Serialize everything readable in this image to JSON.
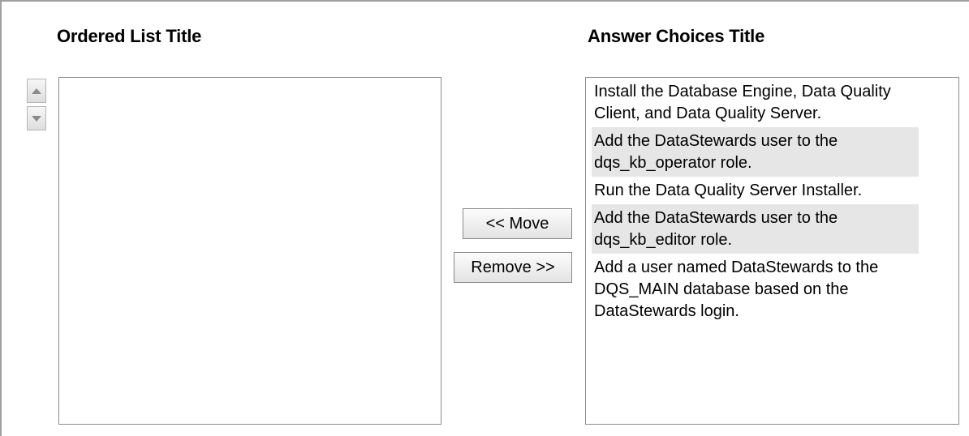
{
  "ordered_list": {
    "title": "Ordered List Title",
    "items": []
  },
  "answer_choices": {
    "title": "Answer Choices Title",
    "items": [
      "Install the Database Engine, Data Quality Client, and Data Quality Server.",
      "Add the DataStewards user to the dqs_kb_operator role.",
      "Run the Data Quality Server Installer.",
      "Add the DataStewards user to the dqs_kb_editor role.",
      "Add a user named DataStewards to the DQS_MAIN database based on the DataStewards login."
    ]
  },
  "buttons": {
    "move": "<< Move",
    "remove": "Remove >>"
  },
  "icons": {
    "up": "arrow-up-icon",
    "down": "arrow-down-icon"
  },
  "colors": {
    "shaded_row": "#e6e6e6",
    "border": "#8c8c8c"
  }
}
